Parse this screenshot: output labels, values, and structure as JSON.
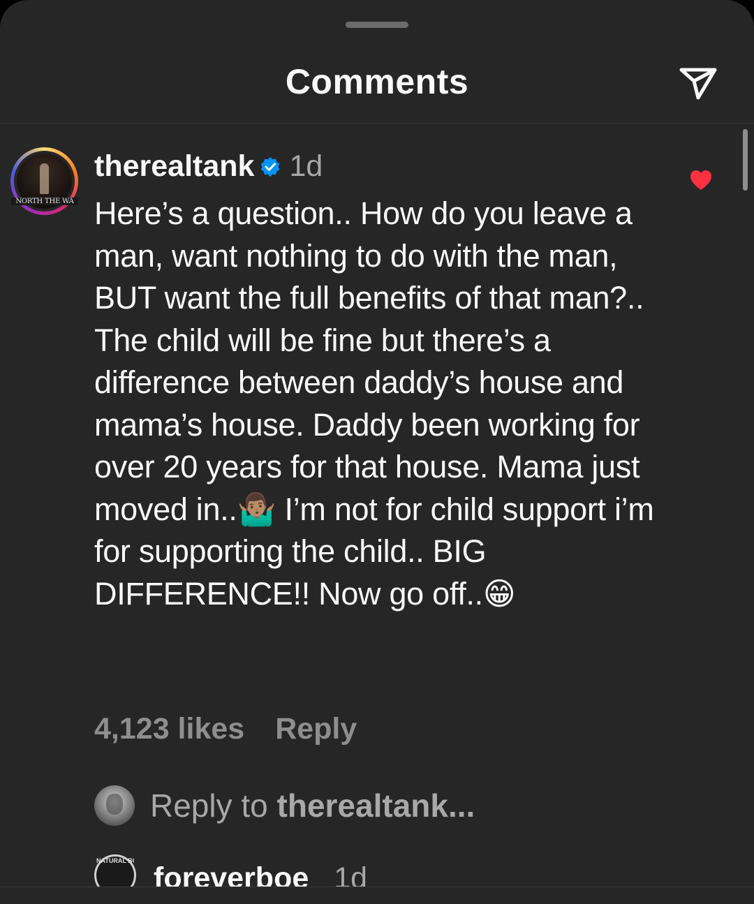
{
  "header": {
    "title": "Comments",
    "send_icon": "paper-plane-icon"
  },
  "comment": {
    "avatar_caption": "NORTH THE WA",
    "username": "therealtank",
    "verified": true,
    "time": "1d",
    "text": "Here’s a question.. How do you leave a man, want nothing to do with the man, BUT want the full benefits of that man?.. The child will be fine but there’s a difference between daddy’s house and mama’s house. Daddy been working for over 20 years for that house. Mama just moved in..🤷🏽‍♂️ I’m not for child support i’m for supporting the child.. BIG DIFFERENCE!! Now go off..😁",
    "likes": "4,123 likes",
    "reply_label": "Reply",
    "liked": true,
    "heart_color": "#ff3040"
  },
  "reply_box": {
    "prompt": "Reply to ",
    "target": "therealtank..."
  },
  "next_comment": {
    "avatar_caption": "NATURAL BORN",
    "username": "foreverboe",
    "time": "1d"
  },
  "colors": {
    "background": "#262626",
    "verified_blue": "#0095f6"
  }
}
